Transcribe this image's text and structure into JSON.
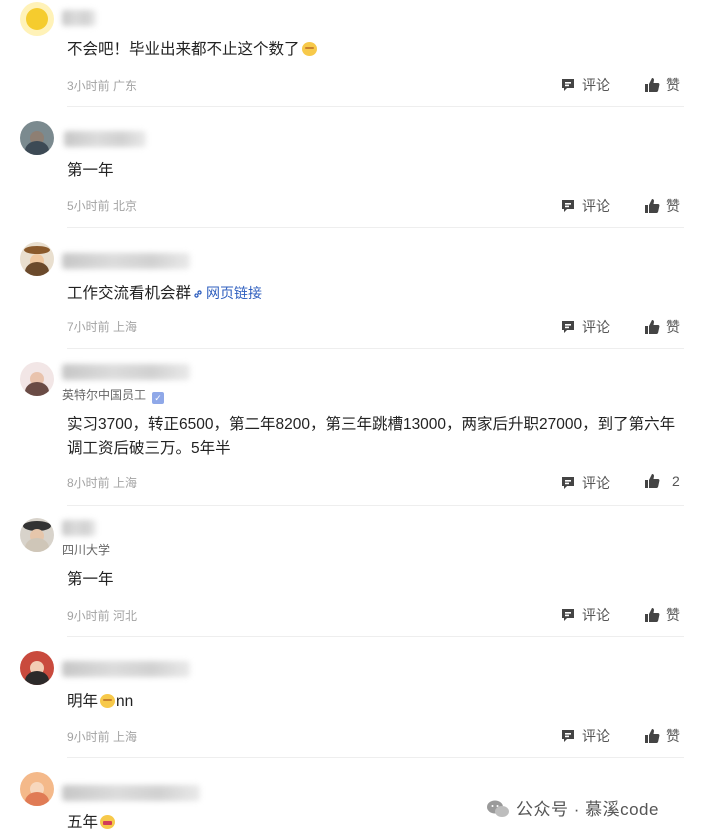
{
  "labels": {
    "comment": "评论",
    "like": "赞"
  },
  "comments": [
    {
      "content": "不会吧！毕业出来都不止这个数了",
      "has_emoji": true,
      "meta": "3小时前 广东",
      "like": "赞"
    },
    {
      "content": "第一年",
      "meta": "5小时前 北京",
      "like": "赞"
    },
    {
      "content": "工作交流看机会群",
      "link": "网页链接",
      "meta": "7小时前 上海",
      "like": "赞"
    },
    {
      "subtitle": "英特尔中国员工",
      "content": "实习3700，转正6500，第二年8200，第三年跳槽13000，两家后升职27000，到了第六年调工资后破三万。5年半",
      "meta": "8小时前 上海",
      "like": "2"
    },
    {
      "subtitle": "四川大学",
      "content": "第一年",
      "meta": "9小时前 河北",
      "like": "赞"
    },
    {
      "content": "明年",
      "content_suffix": "nn",
      "meta": "9小时前 上海",
      "like": "赞"
    },
    {
      "content": "五年"
    }
  ],
  "watermark": "公众号 · 慕溪code",
  "colors": {
    "link": "#2f5fbf",
    "meta": "#a3a3a3",
    "divider": "#eeeeee"
  }
}
